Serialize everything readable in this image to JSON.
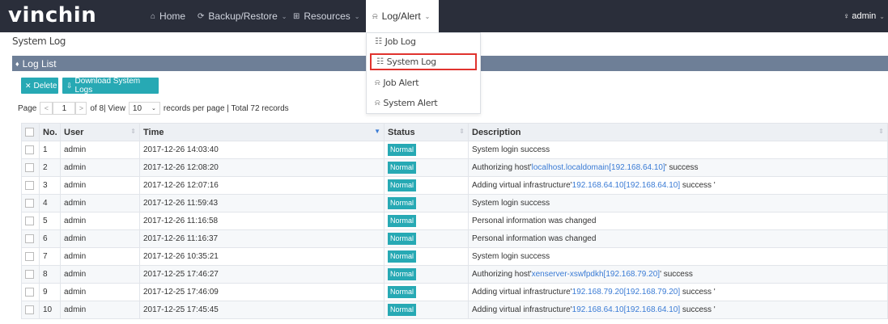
{
  "brand": {
    "logo": "vinchin"
  },
  "nav": {
    "home": {
      "icon": "home-icon",
      "glyph": "⌂",
      "label": "Home"
    },
    "backup": {
      "icon": "backup-restore-icon",
      "glyph": "⟳",
      "label": "Backup/Restore"
    },
    "resources": {
      "icon": "resources-icon",
      "glyph": "⊞",
      "label": "Resources"
    },
    "log": {
      "icon": "bell-icon",
      "glyph": "⍾",
      "label": "Log/Alert"
    },
    "chevron": "⌄",
    "user": {
      "icon": "user-icon",
      "glyph": "♀",
      "label": "admin"
    }
  },
  "dropdown": {
    "items": [
      {
        "icon": "job-log-icon",
        "glyph": "☷",
        "label": "Job Log"
      },
      {
        "icon": "system-log-icon",
        "glyph": "☷",
        "label": "System Log"
      },
      {
        "icon": "job-alert-icon",
        "glyph": "⍾",
        "label": "Job Alert"
      },
      {
        "icon": "system-alert-icon",
        "glyph": "⍾",
        "label": "System Alert"
      }
    ]
  },
  "page": {
    "title": "System Log"
  },
  "panel": {
    "title": "Log List",
    "icon": "list-icon",
    "glyph": "♦"
  },
  "toolbar": {
    "delete_label": "Delete",
    "delete_icon": "trash-icon",
    "delete_glyph": "✕",
    "download_label": "Download System Logs",
    "download_icon": "download-icon",
    "download_glyph": "⇩"
  },
  "pager": {
    "page_label": "Page",
    "prev": "<",
    "current": "1",
    "next": ">",
    "of_label": "of 8| View",
    "per_page": "10",
    "per_page_suffix": "records per page | Total 72 records"
  },
  "table": {
    "headers": {
      "no": "No.",
      "user": "User",
      "time": "Time",
      "status": "Status",
      "description": "Description"
    },
    "rows": [
      {
        "no": "1",
        "user": "admin",
        "time": "2017-12-26 14:03:40",
        "status": "Normal",
        "description": {
          "prefix": "System login success",
          "link": "",
          "suffix": ""
        }
      },
      {
        "no": "2",
        "user": "admin",
        "time": "2017-12-26 12:08:20",
        "status": "Normal",
        "description": {
          "prefix": "Authorizing host'",
          "link": "localhost.localdomain[192.168.64.10]",
          "suffix": "' success"
        }
      },
      {
        "no": "3",
        "user": "admin",
        "time": "2017-12-26 12:07:16",
        "status": "Normal",
        "description": {
          "prefix": "Adding virtual infrastructure'",
          "link": "192.168.64.10[192.168.64.10]",
          "suffix": " success '"
        }
      },
      {
        "no": "4",
        "user": "admin",
        "time": "2017-12-26 11:59:43",
        "status": "Normal",
        "description": {
          "prefix": "System login success",
          "link": "",
          "suffix": ""
        }
      },
      {
        "no": "5",
        "user": "admin",
        "time": "2017-12-26 11:16:58",
        "status": "Normal",
        "description": {
          "prefix": "Personal information was changed",
          "link": "",
          "suffix": ""
        }
      },
      {
        "no": "6",
        "user": "admin",
        "time": "2017-12-26 11:16:37",
        "status": "Normal",
        "description": {
          "prefix": "Personal information was changed",
          "link": "",
          "suffix": ""
        }
      },
      {
        "no": "7",
        "user": "admin",
        "time": "2017-12-26 10:35:21",
        "status": "Normal",
        "description": {
          "prefix": "System login success",
          "link": "",
          "suffix": ""
        }
      },
      {
        "no": "8",
        "user": "admin",
        "time": "2017-12-25 17:46:27",
        "status": "Normal",
        "description": {
          "prefix": "Authorizing host'",
          "link": "xenserver-xswfpdkh[192.168.79.20]",
          "suffix": "' success"
        }
      },
      {
        "no": "9",
        "user": "admin",
        "time": "2017-12-25 17:46:09",
        "status": "Normal",
        "description": {
          "prefix": "Adding virtual infrastructure'",
          "link": "192.168.79.20[192.168.79.20]",
          "suffix": " success '"
        }
      },
      {
        "no": "10",
        "user": "admin",
        "time": "2017-12-25 17:45:45",
        "status": "Normal",
        "description": {
          "prefix": "Adding virtual infrastructure'",
          "link": "192.168.64.10[192.168.64.10]",
          "suffix": " success '"
        }
      }
    ]
  },
  "colors": {
    "topbar": "#2a2e3a",
    "panel_header": "#6e7f97",
    "accent": "#27a9b4",
    "link": "#3a7bd5",
    "highlight": "#e0332e"
  }
}
